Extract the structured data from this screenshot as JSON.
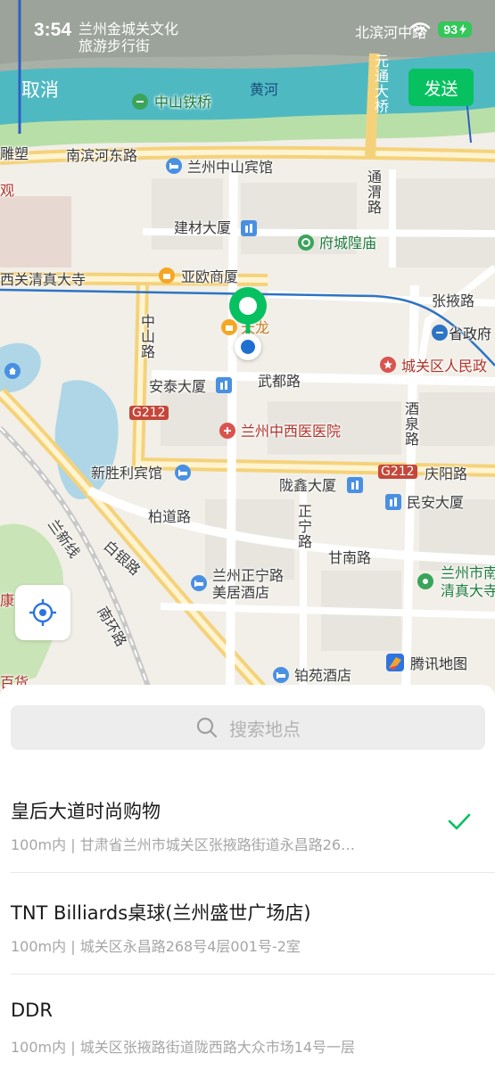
{
  "status_bar": {
    "time": "3:54",
    "battery": "93"
  },
  "header": {
    "cancel_label": "取消",
    "send_label": "发送"
  },
  "map": {
    "labels": {
      "jincheng_guan": "兰州金城关文化",
      "jincheng_guan_2": "旅游步行街",
      "binhe_middle": "北滨河中路",
      "yuantong_bridge": "元通大桥",
      "zhongshan_bridge": "中山铁桥",
      "yellow_river": "黄河",
      "diao_su": "雕塑",
      "nanbinhe_east": "南滨河东路",
      "zhongshan_hotel": "兰州中山宾馆",
      "tongwei_road": "通渭路",
      "jiancai_tower": "建材大厦",
      "fucheng_temple": "府城隍庙",
      "guan": "观",
      "xiguan_mosque": "西关清真大寺",
      "yaou_mall": "亚欧商厦",
      "zhangye_road": "张掖路",
      "provincial_gov": "省政府",
      "zhongshan_road": "中山路",
      "tianlong": "天龙",
      "chengguan_gov": "城关区人民政",
      "antai_tower": "安泰大厦",
      "wudu_road": "武都路",
      "jiuquan_road": "酒泉路",
      "g212_a": "G212",
      "tcm_hospital": "兰州中西医医院",
      "xinshengli_hotel": "新胜利宾馆",
      "g212_b": "G212",
      "qingyang_road": "庆阳路",
      "longxin_tower": "陇鑫大厦",
      "minan_tower": "民安大厦",
      "baidao_road": "柏道路",
      "zhengning_road": "正宁路",
      "lanxin_rail": "兰新线",
      "baiyin_road": "白银路",
      "gannan_road": "甘南路",
      "lanzhou_south": "兰州市南",
      "qingzhen_da": "清真大寺",
      "zhengning_meiju": "兰州正宁路",
      "zhengning_meiju_2": "美居酒店",
      "kang": "康",
      "nanhuan_road": "南环路",
      "baihuo": "百货",
      "boyuan_hotel": "铂苑酒店"
    },
    "brand_label": "腾讯地图"
  },
  "search": {
    "placeholder": "搜索地点"
  },
  "results": [
    {
      "title": "皇后大道时尚购物",
      "subtitle": "100m内 | 甘肃省兰州市城关区张掖路街道永昌路26…",
      "selected": true
    },
    {
      "title": "TNT Billiards桌球(兰州盛世广场店)",
      "subtitle": "100m内 | 城关区永昌路268号4层001号-2室",
      "selected": false
    },
    {
      "title": "DDR",
      "subtitle": "100m内 | 城关区张掖路街道陇西路大众市场14号一层",
      "selected": false
    }
  ],
  "colors": {
    "accent": "#07c160",
    "river": "#4fc0c5",
    "major_road": "#f5d27a"
  }
}
